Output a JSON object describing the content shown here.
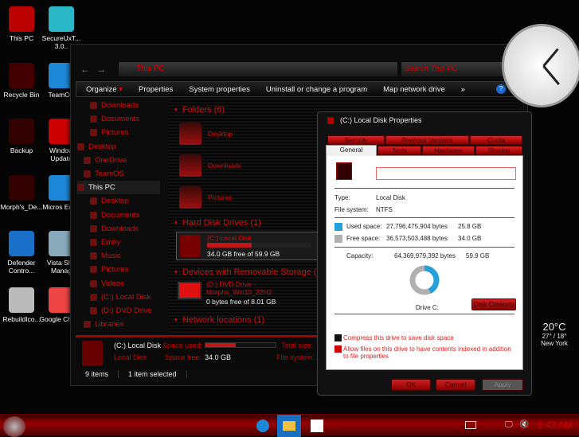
{
  "desktop": {
    "col1": [
      "This PC",
      "Recycle Bin",
      "Backup",
      "Morph's_De...",
      "Defender Contro...",
      "RebuildIco..."
    ],
    "col2": [
      "SecureUxT... 3.0..",
      "TeamOS",
      "Window Update",
      "Micros Edge",
      "Vista Sho Manag",
      "Google Chrom"
    ]
  },
  "explorer": {
    "address": "This PC",
    "search_placeholder": "Search This PC",
    "toolbar": [
      "Organize",
      "Properties",
      "System properties",
      "Uninstall or change a program",
      "Map network drive",
      "»"
    ],
    "nav": [
      "Downloads",
      "Documents",
      "Pictures",
      "Desktop",
      "OneDrive",
      "TeamOS",
      "This PC",
      "Desktop",
      "Documents",
      "Downloads",
      "Emby",
      "Music",
      "Pictures",
      "Videos",
      "(C:) Local Disk",
      "(D:) DVD Drive",
      "Libraries"
    ],
    "groups": {
      "folders": "Folders (6)",
      "hdd": "Hard Disk Drives (1)",
      "removable": "Devices with Removable Storage (1)",
      "network": "Network locations (1)"
    },
    "folders": [
      "Desktop",
      "Downloads",
      "Pictures"
    ],
    "c_drive": {
      "name": "(C:) Local Disk",
      "free": "34.0 GB free of 59.9 GB",
      "used_fraction": 0.43
    },
    "d_drive": {
      "name": "(D:) DVD Drive - Morphs_Win10_22H2",
      "free": "0 bytes free of 8.01 GB"
    },
    "details": {
      "name": "(C:) Local Disk",
      "type": "Local Disk",
      "space_used_label": "Space used:",
      "space_free_label": "Space free:",
      "space_free": "34.0 GB",
      "total_label": "Total size:",
      "fs_label": "File system:"
    },
    "status": {
      "items": "9 items",
      "selected": "1 item selected"
    }
  },
  "dialog": {
    "title": "(C:) Local Disk Properties",
    "tabs_back": [
      "Security",
      "Previous Versions",
      "Quota"
    ],
    "tabs_front": [
      "General",
      "Tools",
      "Hardware",
      "Sharing"
    ],
    "name_value": "",
    "type_label": "Type:",
    "type": "Local Disk",
    "fs_label": "File system:",
    "fs": "NTFS",
    "used_label": "Used space:",
    "used_bytes": "27,796,475,904 bytes",
    "used_gb": "25.8 GB",
    "free_label": "Free space:",
    "free_bytes": "36,573,503,488 bytes",
    "free_gb": "34.0 GB",
    "cap_label": "Capacity:",
    "cap_bytes": "64,369,979,392 bytes",
    "cap_gb": "59.9 GB",
    "drive_label": "Drive C:",
    "cleanup": "Disk Cleanup",
    "compress": "Compress this drive to save disk space",
    "compress_checked": false,
    "index": "Allow files on this drive to have contents indexed in addition to file properties",
    "index_checked": true,
    "ok": "OK",
    "cancel": "Cancel",
    "apply": "Apply",
    "used_color": "#26a0da",
    "free_color": "#b0b0b0"
  },
  "weather": {
    "temp": "20°C",
    "range": "27° / 18°",
    "city": "New York"
  },
  "taskbar": {
    "time": "1:42 AM"
  }
}
